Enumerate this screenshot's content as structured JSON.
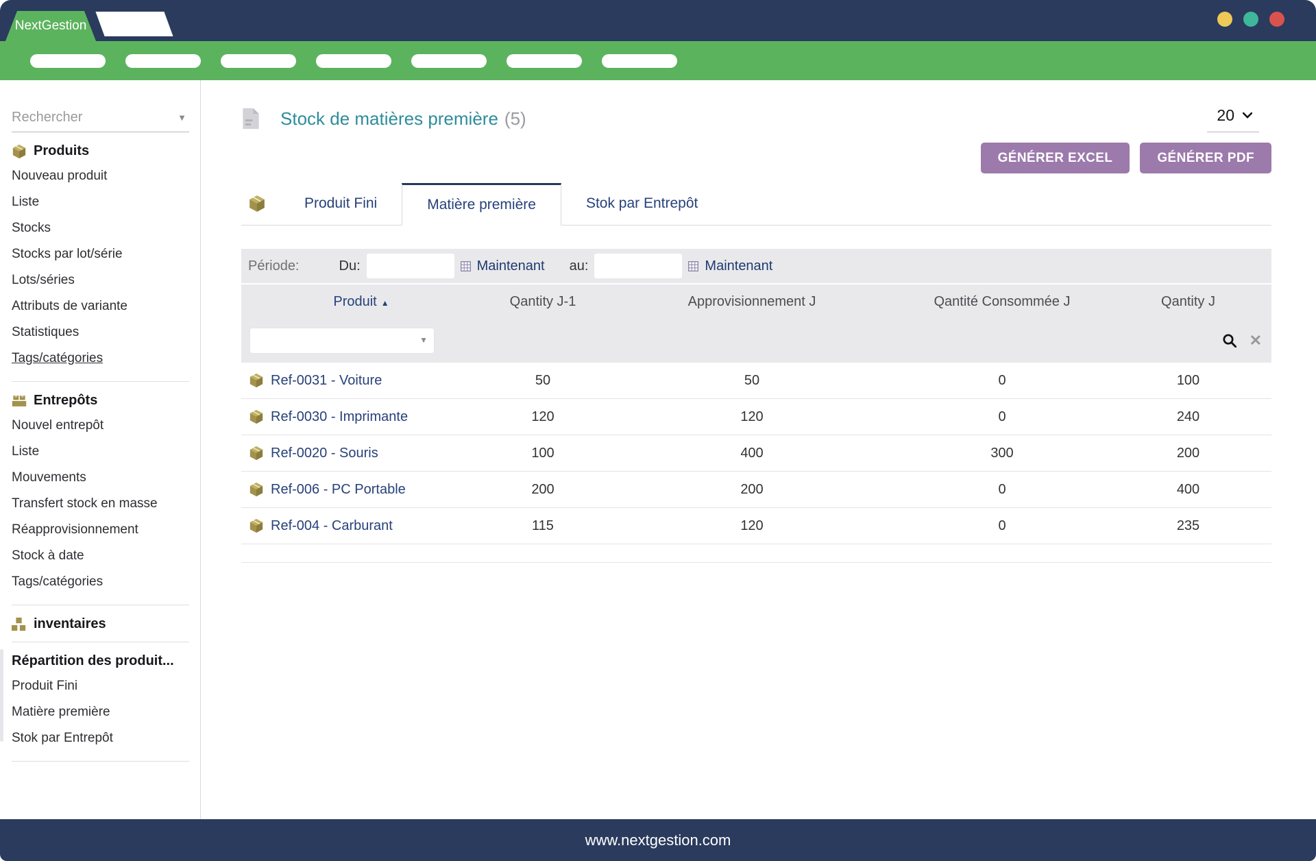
{
  "colors": {
    "navy": "#2a3b5d",
    "green": "#5cb35e",
    "gold": "#a2924c",
    "teal": "#2e8c9c",
    "purple": "#9c7aac",
    "link_navy": "#27417a"
  },
  "window": {
    "brand": "NextGestion",
    "controls": [
      {
        "name": "minimize-dot",
        "color": "#eec957"
      },
      {
        "name": "restore-dot",
        "color": "#3eb79b"
      },
      {
        "name": "close-dot",
        "color": "#d9534e"
      }
    ],
    "footer_url": "www.nextgestion.com"
  },
  "navbar": {
    "pill_count": 7
  },
  "sidebar": {
    "search_placeholder": "Rechercher",
    "sections": [
      {
        "title": "Produits",
        "icon": "package-icon",
        "items": [
          {
            "label": "Nouveau produit"
          },
          {
            "label": "Liste"
          },
          {
            "label": "Stocks"
          },
          {
            "label": "Stocks par lot/série"
          },
          {
            "label": "Lots/séries"
          },
          {
            "label": "Attributs de variante"
          },
          {
            "label": "Statistiques"
          },
          {
            "label": "Tags/catégories",
            "underline": true
          }
        ]
      },
      {
        "title": "Entrepôts",
        "icon": "warehouse-icon",
        "items": [
          {
            "label": "Nouvel entrepôt"
          },
          {
            "label": "Liste"
          },
          {
            "label": "Mouvements"
          },
          {
            "label": "Transfert stock en masse"
          },
          {
            "label": "Réapprovisionnement"
          },
          {
            "label": "Stock à date"
          },
          {
            "label": "Tags/catégories"
          }
        ]
      },
      {
        "title": "inventaires",
        "icon": "cubes-icon",
        "items": []
      },
      {
        "title": "Répartition des produit...",
        "icon": null,
        "items": [
          {
            "label": "Produit Fini"
          },
          {
            "label": "Matière première"
          },
          {
            "label": "Stok par Entrepôt"
          }
        ]
      }
    ]
  },
  "main": {
    "title": "Stock de matières première",
    "title_count": "(5)",
    "page_size": "20",
    "buttons": {
      "excel": "GÉNÉRER EXCEL",
      "pdf": "GÉNÉRER PDF"
    },
    "tabs": [
      {
        "label": "Produit Fini",
        "active": false
      },
      {
        "label": "Matière première",
        "active": true
      },
      {
        "label": "Stok par Entrepôt",
        "active": false
      }
    ],
    "periode": {
      "label": "Période:",
      "from_label": "Du:",
      "from_value": "",
      "to_label": "au:",
      "to_value": "",
      "now_label": "Maintenant"
    },
    "table": {
      "columns": [
        {
          "label": "Produit",
          "sort": "asc"
        },
        {
          "label": "Qantity J-1",
          "sort": null
        },
        {
          "label": "Approvisionnement J",
          "sort": null
        },
        {
          "label": "Qantité Consommée J",
          "sort": null
        },
        {
          "label": "Qantity J",
          "sort": null
        }
      ],
      "filter_value": "",
      "rows": [
        {
          "produit": "Ref-0031 - Voiture",
          "qty_j1": "50",
          "appro_j": "50",
          "conso_j": "0",
          "qty_j": "100"
        },
        {
          "produit": "Ref-0030 - Imprimante",
          "qty_j1": "120",
          "appro_j": "120",
          "conso_j": "0",
          "qty_j": "240"
        },
        {
          "produit": "Ref-0020 - Souris",
          "qty_j1": "100",
          "appro_j": "400",
          "conso_j": "300",
          "qty_j": "200"
        },
        {
          "produit": "Ref-006 - PC Portable",
          "qty_j1": "200",
          "appro_j": "200",
          "conso_j": "0",
          "qty_j": "400"
        },
        {
          "produit": "Ref-004 - Carburant",
          "qty_j1": "115",
          "appro_j": "120",
          "conso_j": "0",
          "qty_j": "235"
        }
      ]
    }
  }
}
